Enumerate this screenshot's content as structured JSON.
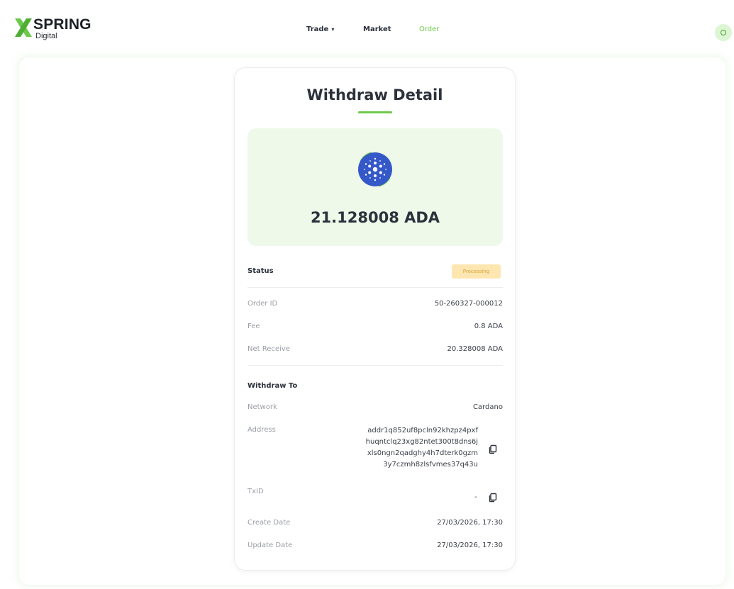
{
  "brand": {
    "name": "SPRING",
    "sub": "Digital",
    "accent_color": "#6cc94b"
  },
  "nav": {
    "items": [
      {
        "label": "Trade",
        "has_dropdown": true,
        "active": false
      },
      {
        "label": "Market",
        "has_dropdown": false,
        "active": false
      },
      {
        "label": "Order",
        "has_dropdown": false,
        "active": true
      }
    ]
  },
  "user": {
    "icon": "user-icon"
  },
  "page": {
    "title": "Withdraw Detail",
    "amount": "21.128008 ADA",
    "coin_icon": "cardano-icon",
    "coin_color": "#3558c9"
  },
  "status": {
    "label": "Status",
    "badge": "Processing",
    "badge_color": "#fde6b0"
  },
  "details": [
    {
      "label": "Order ID",
      "value": "50-260327-000012"
    },
    {
      "label": "Fee",
      "value": "0.8 ADA"
    },
    {
      "label": "Net Receive",
      "value": "20.328008 ADA"
    }
  ],
  "withdraw_to": {
    "heading": "Withdraw To",
    "network_label": "Network",
    "network_value": "Cardano",
    "address_label": "Address",
    "address_lines": [
      "addr1q852uf8pcln92khzpz4pxf",
      "huqntclq23xg82ntet300t8dns6j",
      "xls0ngn2qadghy4h7dterk0gzm",
      "3y7czmh8zlsfvmes37q43u"
    ],
    "txid_label": "TxID",
    "txid_value": "-",
    "create_label": "Create Date",
    "create_value": "27/03/2026, 17:30",
    "update_label": "Update Date",
    "update_value": "27/03/2026, 17:30"
  }
}
